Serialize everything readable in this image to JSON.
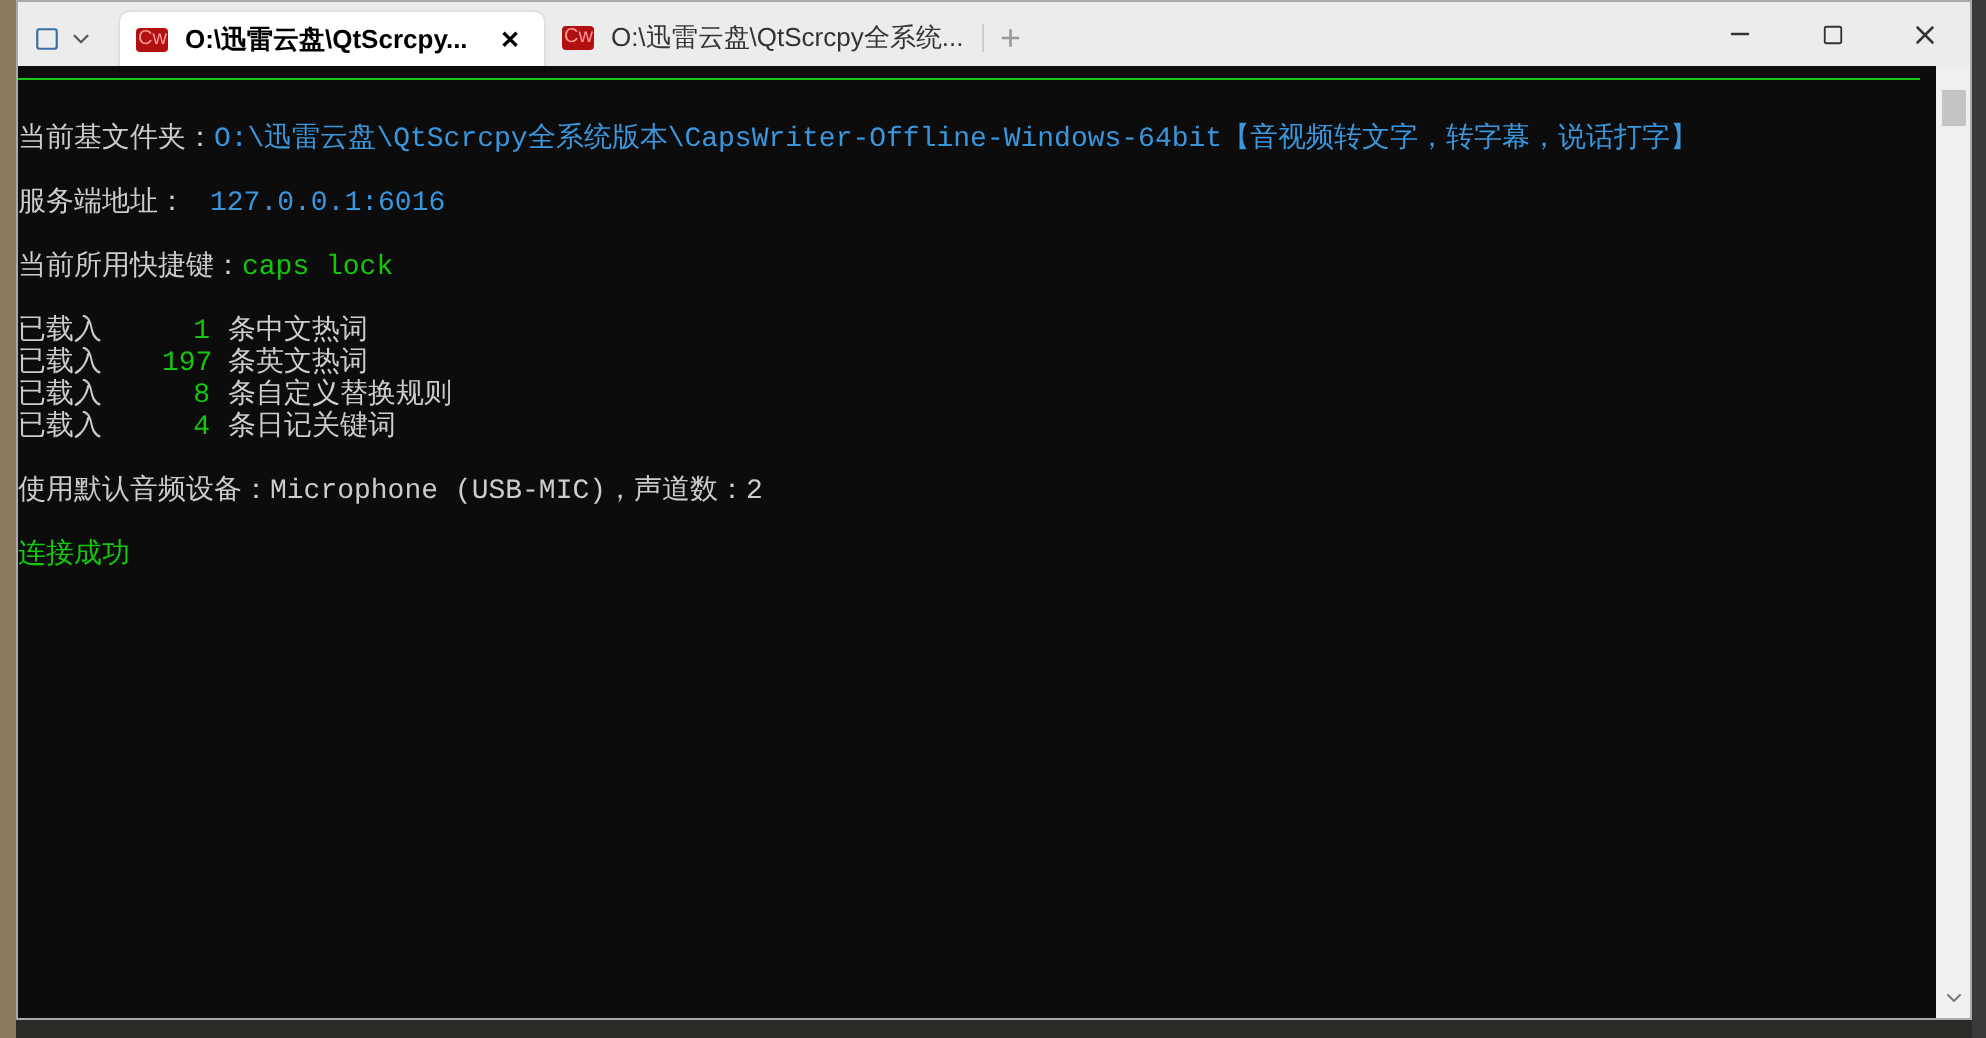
{
  "tabs": [
    {
      "icon_text": "Cw",
      "title": "O:\\迅雷云盘\\QtScrcpy...",
      "selected": true,
      "close": "✕"
    },
    {
      "icon_text": "Cw",
      "title": "O:\\迅雷云盘\\QtScrcpy全系统...",
      "selected": false
    }
  ],
  "new_tab": "+",
  "console": {
    "folder_label": "当前基文件夹：",
    "folder_path": "O:\\迅雷云盘\\QtScrcpy全系统版本\\CapsWriter-Offline-Windows-64bit【音视频转文字，转字幕，说话打字】",
    "server_label": "服务端地址：",
    "server_address": "127.0.0.1:6016",
    "hotkey_label": "当前所用快捷键：",
    "hotkey": "caps lock",
    "loaded": [
      {
        "prefix": "已载入",
        "count": "1",
        "text": "条中文热词"
      },
      {
        "prefix": "已载入",
        "count": "197",
        "text": "条英文热词"
      },
      {
        "prefix": "已载入",
        "count": "8",
        "text": "条自定义替换规则"
      },
      {
        "prefix": "已载入",
        "count": "4",
        "text": "条日记关键词"
      }
    ],
    "device_line": "使用默认音频设备：Microphone (USB-MIC)，声道数：2",
    "status": "连接成功"
  }
}
